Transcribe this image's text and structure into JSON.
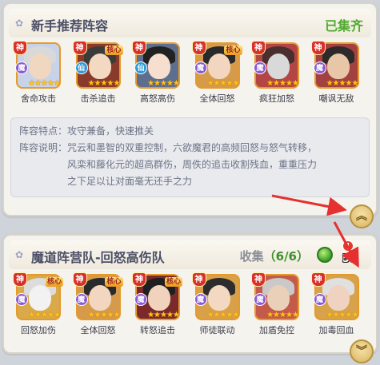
{
  "panel1": {
    "title": "新手推荐阵容",
    "status": "已集齐",
    "heroes": [
      {
        "skill": "舍命攻击",
        "shen": "神",
        "faction": "魔",
        "core": "",
        "stars": "★★★★★",
        "faction_color": "#8a5bd1",
        "hair": "#d9d9d9",
        "face": "#f0d7c0",
        "bg": "#c8d2e8"
      },
      {
        "skill": "击杀追击",
        "shen": "神",
        "faction": "仙",
        "core": "核心",
        "stars": "★★★★★",
        "faction_color": "#2f9ad6",
        "hair": "#3b3b3b",
        "face": "#f3d8c2",
        "bg": "#8a3a2a"
      },
      {
        "skill": "高怒高伤",
        "shen": "神",
        "faction": "仙",
        "core": "",
        "stars": "★★★★★",
        "faction_color": "#2f9ad6",
        "hair": "#222222",
        "face": "#f6dfcf",
        "bg": "#5d6e8f"
      },
      {
        "skill": "全体回怒",
        "shen": "神",
        "faction": "魔",
        "core": "核心",
        "stars": "★★★★★",
        "faction_color": "#8a5bd1",
        "hair": "#2a2a2a",
        "face": "#f3d6c0",
        "bg": "#d59a4a"
      },
      {
        "skill": "疯狂加怒",
        "shen": "神",
        "faction": "魔",
        "core": "",
        "stars": "★★★★★",
        "faction_color": "#8a5bd1",
        "hair": "#4b2f2f",
        "face": "#d9d9d9",
        "bg": "#b44545"
      },
      {
        "skill": "嘲讽无敌",
        "shen": "神",
        "faction": "魔",
        "core": "",
        "stars": "★★★★★",
        "faction_color": "#8a5bd1",
        "hair": "#2e2a2a",
        "face": "#e8c7a8",
        "bg": "#a34040"
      }
    ],
    "desc": {
      "feature_label": "阵容特点：",
      "feature_text": "攻守兼备，快速推关",
      "explain_label": "阵容说明：",
      "explain_lines": [
        "咒云和墨智的双重控制，六欲魔君的高频回怒与怒气转移，",
        "风栾和藤化元的超高群伤，周佚的追击收割残血，重重压力",
        "之下足以让对面毫无还手之力"
      ]
    },
    "toggle": "︽"
  },
  "panel2": {
    "title": "魔道阵营队-回怒高伤队",
    "collect_label": "收集",
    "collect_value": "（6/6）",
    "gem_count": "50",
    "alert": "!",
    "heroes": [
      {
        "skill": "回怒加伤",
        "shen": "神",
        "faction": "魔",
        "core": "核心",
        "stars": "★★★★★",
        "faction_color": "#8a5bd1",
        "hair": "#dcdcdc",
        "face": "#f2f2f2",
        "bg": "#d9a94a"
      },
      {
        "skill": "全体回怒",
        "shen": "神",
        "faction": "魔",
        "core": "核心",
        "stars": "★★★★★",
        "faction_color": "#8a5bd1",
        "hair": "#2a2a2a",
        "face": "#f3d6c0",
        "bg": "#d59a4a"
      },
      {
        "skill": "转怒追击",
        "shen": "神",
        "faction": "魔",
        "core": "核心",
        "stars": "★★★★★",
        "faction_color": "#8a5bd1",
        "hair": "#1f1f1f",
        "face": "#f1d3bd",
        "bg": "#7a2a2a"
      },
      {
        "skill": "师徒联动",
        "shen": "神",
        "faction": "魔",
        "core": "",
        "stars": "★★★★★",
        "faction_color": "#8a5bd1",
        "hair": "#2d2d2d",
        "face": "#f3d8c2",
        "bg": "#d9a04a"
      },
      {
        "skill": "加盾免控",
        "shen": "神",
        "faction": "魔",
        "core": "",
        "stars": "★★★★★",
        "faction_color": "#8a5bd1",
        "hair": "#c9c9c9",
        "face": "#ead0b8",
        "bg": "#c45a4a"
      },
      {
        "skill": "加毒回血",
        "shen": "神",
        "faction": "魔",
        "core": "",
        "stars": "★★★★★",
        "faction_color": "#8a5bd1",
        "hair": "#e0e0e0",
        "face": "#f0d2c0",
        "bg": "#d7a24a"
      }
    ],
    "toggle": "︾"
  }
}
